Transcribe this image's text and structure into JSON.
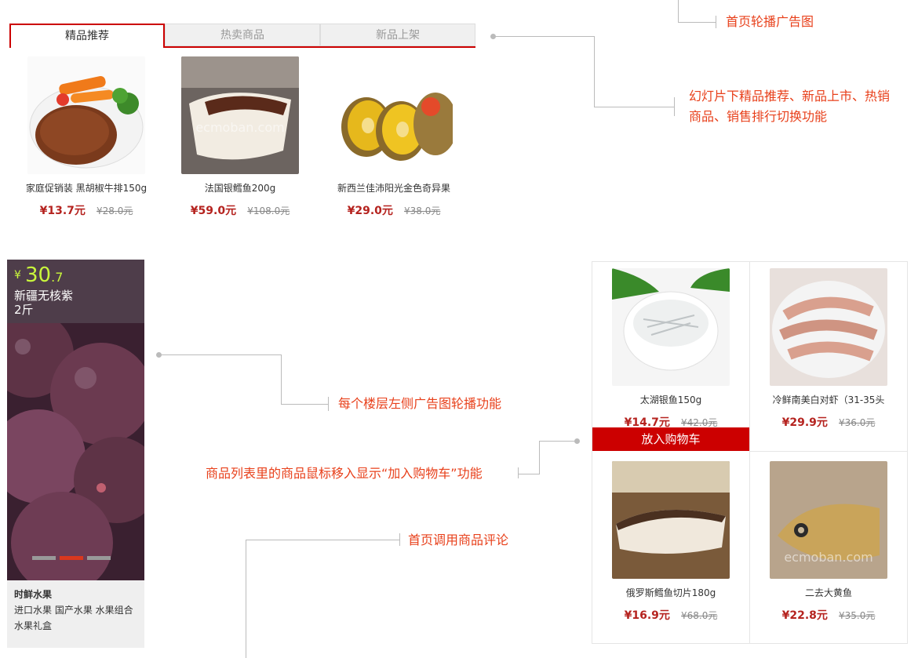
{
  "tabs": [
    {
      "label": "精品推荐"
    },
    {
      "label": "热卖商品"
    },
    {
      "label": "新品上架"
    }
  ],
  "products_top": [
    {
      "name": "家庭促销装 黑胡椒牛排150g",
      "price": "¥13.7元",
      "old_price": "¥28.0元",
      "image": "steak"
    },
    {
      "name": "法国银鳕鱼200g",
      "price": "¥59.0元",
      "old_price": "¥108.0元",
      "image": "cod"
    },
    {
      "name": "新西兰佳沛阳光金色奇异果",
      "price": "¥29.0元",
      "old_price": "¥38.0元",
      "image": "kiwi"
    }
  ],
  "annotations": {
    "carousel": "首页轮播广告图",
    "tabs_switch": "幻灯片下精品推荐、新品上市、热销商品、销售排行切换功能",
    "floor_banner": "每个楼层左侧广告图轮播功能",
    "add_cart": "商品列表里的商品鼠标移入显示“加入购物车”功能",
    "comments": "首页调用商品评论"
  },
  "banner": {
    "currency": "¥",
    "price_int": "30",
    "price_dec": ".7",
    "title_line1": "新疆无核紫",
    "title_line2": "2斤",
    "category": "时鲜水果",
    "subcats_line1": "进口水果  国产水果  水果组合",
    "subcats_line2": "水果礼盒",
    "active_dot": 1
  },
  "grid_products": [
    {
      "name": "太湖银鱼150g",
      "price": "¥14.7元",
      "old_price": "¥42.0元",
      "image": "whitebait"
    },
    {
      "name": "冷鲜南美白对虾（31-35头",
      "price": "¥29.9元",
      "old_price": "¥36.0元",
      "image": "shrimp"
    },
    {
      "name": "俄罗斯鳕鱼切片180g",
      "price": "¥16.9元",
      "old_price": "¥68.0元",
      "image": "cod-slice"
    },
    {
      "name": "二去大黄鱼",
      "price": "¥22.8元",
      "old_price": "¥35.0元",
      "image": "yellow-croaker"
    }
  ],
  "cart_button": "放入购物车",
  "colors": {
    "accent": "#cc0000",
    "note": "#e8401b",
    "price": "#b5231f",
    "banner_top": "#4e3d4a",
    "price_highlight": "#c8f53c"
  }
}
